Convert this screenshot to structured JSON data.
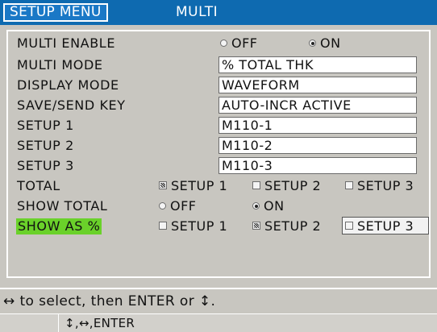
{
  "header": {
    "tab_label": "SETUP MENU",
    "title": "MULTI"
  },
  "rows": {
    "multi_enable": {
      "label": "MULTI ENABLE",
      "off": "OFF",
      "on": "ON",
      "selected": "ON"
    },
    "multi_mode": {
      "label": "MULTI MODE",
      "value": "% TOTAL THK"
    },
    "display_mode": {
      "label": "DISPLAY MODE",
      "value": "WAVEFORM"
    },
    "save_send_key": {
      "label": "SAVE/SEND KEY",
      "value": "AUTO-INCR ACTIVE"
    },
    "setup1": {
      "label": "SETUP 1",
      "value": "M110-1"
    },
    "setup2": {
      "label": "SETUP 2",
      "value": "M110-2"
    },
    "setup3": {
      "label": "SETUP 3",
      "value": "M110-3"
    },
    "total": {
      "label": "TOTAL",
      "opt1": "SETUP 1",
      "opt2": "SETUP 2",
      "opt3": "SETUP 3",
      "checked": [
        "SETUP 1"
      ]
    },
    "show_total": {
      "label": "SHOW TOTAL",
      "off": "OFF",
      "on": "ON",
      "selected": "ON"
    },
    "show_as_pct": {
      "label": "SHOW AS %",
      "opt1": "SETUP 1",
      "opt2": "SETUP 2",
      "opt3": "SETUP 3",
      "checked": [
        "SETUP 2"
      ],
      "focused": "SETUP 3"
    }
  },
  "hint": "↔ to select, then ENTER or ↕.",
  "key_bar": "↕,↔,ENTER",
  "colors": {
    "title_bar": "#0e6ab0",
    "highlight": "#6ad12a",
    "background": "#c8c6c0"
  }
}
